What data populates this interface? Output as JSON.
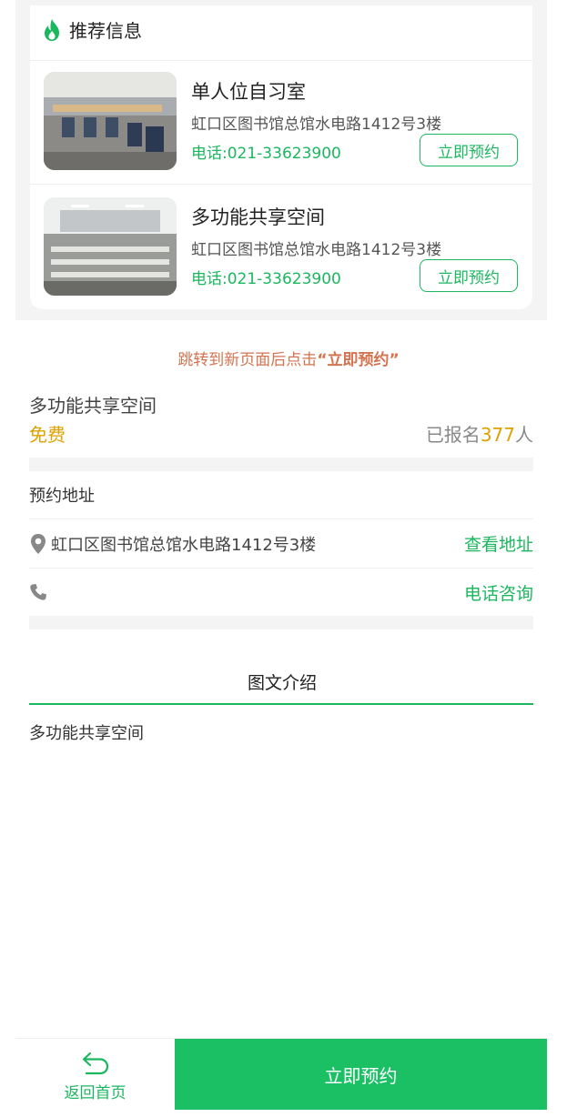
{
  "recommend": {
    "title": "推荐信息",
    "items": [
      {
        "name": "单人位自习室",
        "address": "虹口区图书馆总馆水电路1412号3楼",
        "phone": "电话:021-33623900",
        "button": "立即预约"
      },
      {
        "name": "多功能共享空间",
        "address": "虹口区图书馆总馆水电路1412号3楼",
        "phone": "电话:021-33623900",
        "button": "立即预约"
      }
    ]
  },
  "hint": {
    "prefix": "跳转到新页面后点击",
    "quoted": "“立即预约”"
  },
  "detail": {
    "title": "多功能共享空间",
    "price": "免费",
    "signed_prefix": "已报名",
    "signed_count": "377",
    "signed_suffix": "人"
  },
  "address_section": {
    "heading": "预约地址",
    "address": "虹口区图书馆总馆水电路1412号3楼",
    "view_link": "查看地址",
    "consult_link": "电话咨询"
  },
  "intro": {
    "tab": "图文介绍",
    "content": "多功能共享空间"
  },
  "footer": {
    "back_label": "返回首页",
    "book_label": "立即预约"
  },
  "colors": {
    "accent": "#1bb75f",
    "price": "#e0a100",
    "hint": "#d3734f"
  }
}
